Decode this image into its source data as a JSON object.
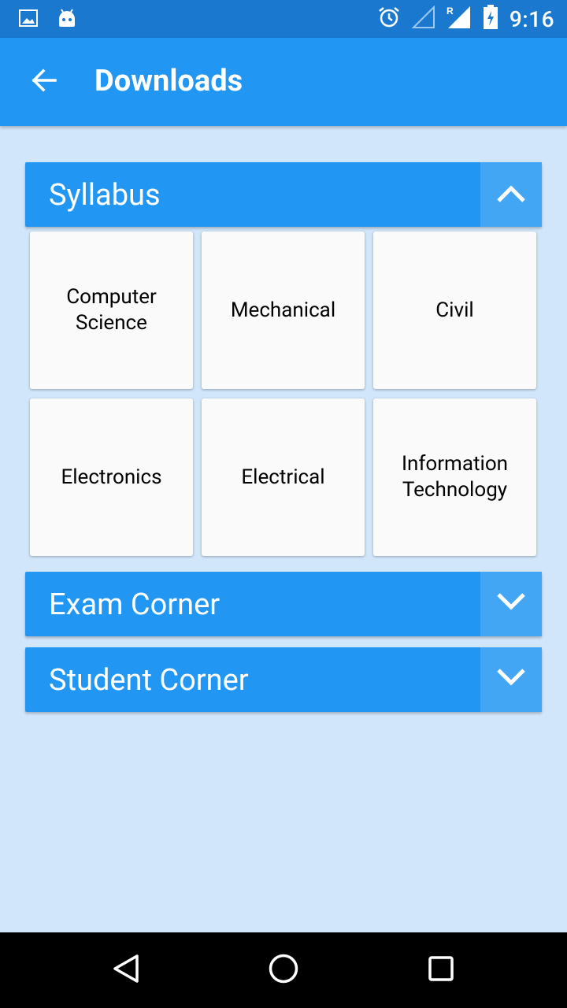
{
  "status_bar": {
    "time": "9:16",
    "left_icons": [
      "image-icon",
      "android-icon"
    ],
    "right_icons": [
      "alarm-icon",
      "signal-empty-icon",
      "signal-roaming-icon",
      "battery-charging-icon"
    ]
  },
  "app_bar": {
    "title": "Downloads",
    "back_icon": "arrow-left-icon"
  },
  "sections": [
    {
      "title": "Syllabus",
      "expanded": true,
      "items": [
        "Computer Science",
        "Mechanical",
        "Civil",
        "Electronics",
        "Electrical",
        "Information Technology"
      ]
    },
    {
      "title": "Exam Corner",
      "expanded": false
    },
    {
      "title": "Student Corner",
      "expanded": false
    }
  ],
  "nav_bar": {
    "buttons": [
      "back-triangle-icon",
      "home-circle-icon",
      "recents-square-icon"
    ]
  },
  "colors": {
    "status_bar": "#1a78cf",
    "primary": "#2196f3",
    "toggle": "#43a6f5",
    "background": "#d1e6fa",
    "tile": "#fafafa"
  }
}
